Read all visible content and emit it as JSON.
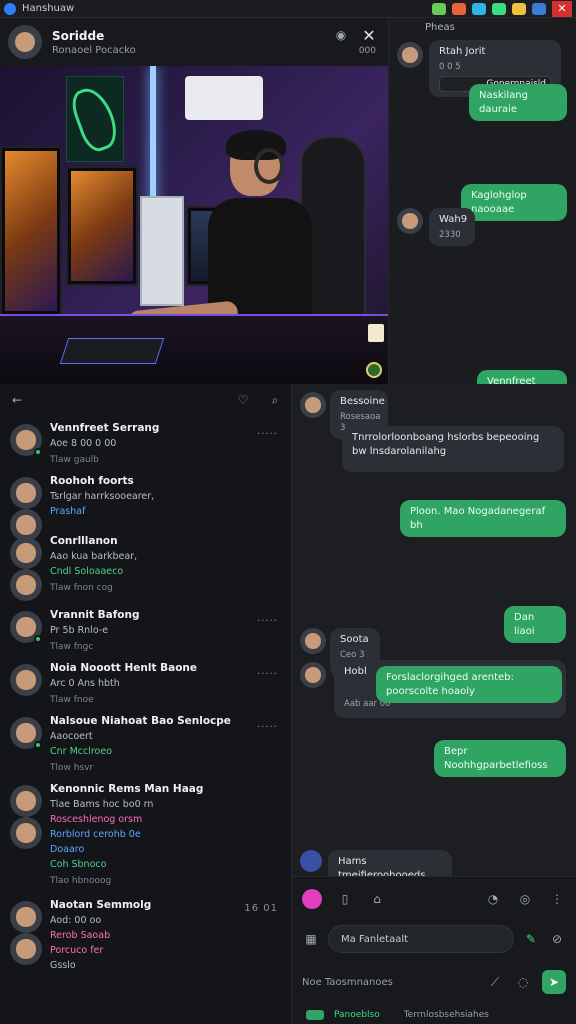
{
  "window": {
    "title": "Hanshuaw"
  },
  "contact": {
    "name": "Soridde",
    "status": "Ronaoel Pocacko",
    "count": "000"
  },
  "right_panel": {
    "label": "Pheas",
    "top_message": {
      "sender": "Rtah Jorit",
      "time": "0 0 5",
      "link": "Gonernnaisld"
    },
    "out1": "Naskilang dauraie",
    "out2": "Kaglohglop naooaae",
    "in2": {
      "sender": "Wah9",
      "meta": "2330"
    }
  },
  "list_toolbar": {},
  "chats": [
    {
      "title": "Vennfreet Serrang",
      "line1": "Aoe 8 00 0 00",
      "time": "Tlaw gaulb",
      "menu": "....."
    },
    {
      "title": "Roohoh foorts",
      "line1": "Tsrlgar harrksooearer,",
      "line2": "Prashaf",
      "time": "",
      "menu": ""
    },
    {
      "title": "Conrlllanon",
      "line1": "Aao kua barkbear,",
      "line2": "Cndl Soloaaeco",
      "time": "Tlaw fnon cog",
      "menu": ""
    },
    {
      "title": "Vrannit Bafong",
      "line1": "Pr 5b Rnlo-e",
      "time": "Tlaw fngc",
      "menu": "....."
    },
    {
      "title": "Noia Nooott Henlt Baone",
      "line1": "Arc 0 Ans hbth",
      "time": "Tlaw fnoe",
      "menu": "....."
    },
    {
      "title": "Nalsoue Niahoat Bao Senlocpe",
      "line1": "Aaocoert",
      "line2": "Cnr Mcclroeo",
      "time": "Tlow hsvr",
      "menu": "....."
    },
    {
      "title": "Kenonnic Rems Man Haag",
      "line1": "Tlae Bams hoc bo0 rn",
      "line2": "Rosceshlenog orsm",
      "line3": "Rorblord cerohb 0e",
      "line4": "Doaaro",
      "line5": "Coh Sbnoco",
      "time": "Tlao hbnooog",
      "menu": ""
    },
    {
      "title": "Naotan Semmolg",
      "line1": "Aod: 00 oo",
      "line2": "Rerob Saoab",
      "line3": "Porcuco fer",
      "line4": "Gsslo",
      "time": "",
      "menu": "16 01"
    }
  ],
  "main_chat": {
    "in1": {
      "sender": "Bessoine",
      "meta": "Rosesaoa 3"
    },
    "in_long": "Tnrrolorloonboang hslorbs bepeooing bw lnsdarolanilahg",
    "out_long": "Ploon. Mao Nogadanegeraf bh",
    "out_short": "Dan liaoi",
    "in3": {
      "sender": "Soota",
      "meta": "Ceo 3 00"
    },
    "quote": {
      "sender": "Hobl",
      "meta": "Aab aar 00",
      "text": "Forslaclorgihged arenteb: poorscolte hoaoly"
    },
    "out_last": "Bepr Noohhgparbetlefioss",
    "bottom": "Hams tmejfieroohooeds"
  },
  "composer": {
    "placeholder": "Ma Fanletaalt",
    "second_placeholder": "Noe Taosmnanoes",
    "footer_left": "Panoeblso",
    "footer_right": "Terrnlosbsehsiahes"
  }
}
